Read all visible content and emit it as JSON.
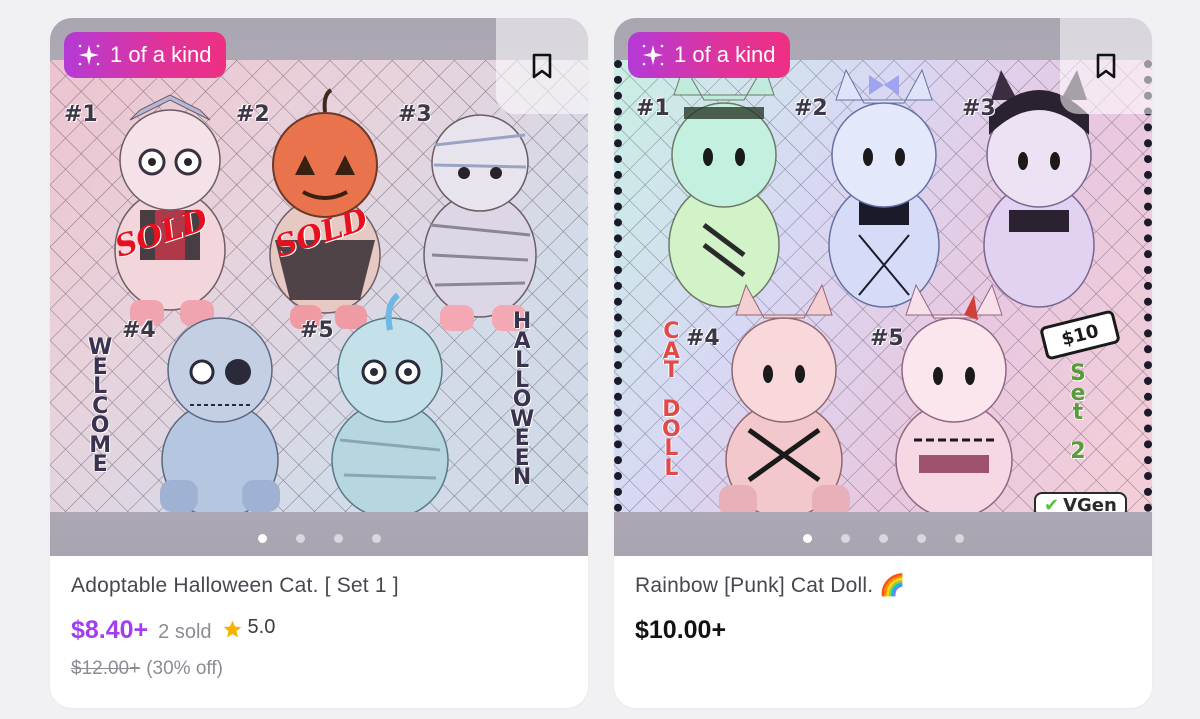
{
  "listings": [
    {
      "badge": "1 of a kind",
      "title": "Adoptable Halloween Cat. [ Set 1 ]",
      "price": "$8.40+",
      "sold": "2 sold",
      "rating": "5.0",
      "original_price": "$12.00+",
      "discount": "(30% off)",
      "carousel_count": 4,
      "art": {
        "labels": [
          "#1",
          "#2",
          "#3",
          "#4",
          "#5"
        ],
        "sold_marks": [
          "SOLD",
          "SOLD"
        ],
        "left_vertical": [
          "W",
          "E",
          "L",
          "C",
          "O",
          "M",
          "E"
        ],
        "right_vertical": [
          "H",
          "A",
          "L",
          "L",
          "O",
          "W",
          "E",
          "E",
          "N"
        ]
      }
    },
    {
      "badge": "1 of a kind",
      "title": "Rainbow [Punk] Cat Doll. 🌈",
      "price": "$10.00+",
      "carousel_count": 5,
      "art": {
        "labels": [
          "#1",
          "#2",
          "#3",
          "#4",
          "#5"
        ],
        "left_vertical": [
          "C",
          "A",
          "T",
          "",
          "D",
          "O",
          "L",
          "L"
        ],
        "right_vertical": [
          "S",
          "e",
          "t",
          "",
          "2"
        ],
        "price_tag": "$10",
        "watermark": "VGen"
      }
    }
  ],
  "colors": {
    "accent_purple": "#a23ef0",
    "badge_start": "#b43ad6",
    "badge_end": "#ee2f83",
    "star": "#f4b400"
  },
  "icons": {
    "badge_icon": "sparkle-icon",
    "save_icon": "bookmark-icon",
    "rating_icon": "star-icon"
  }
}
